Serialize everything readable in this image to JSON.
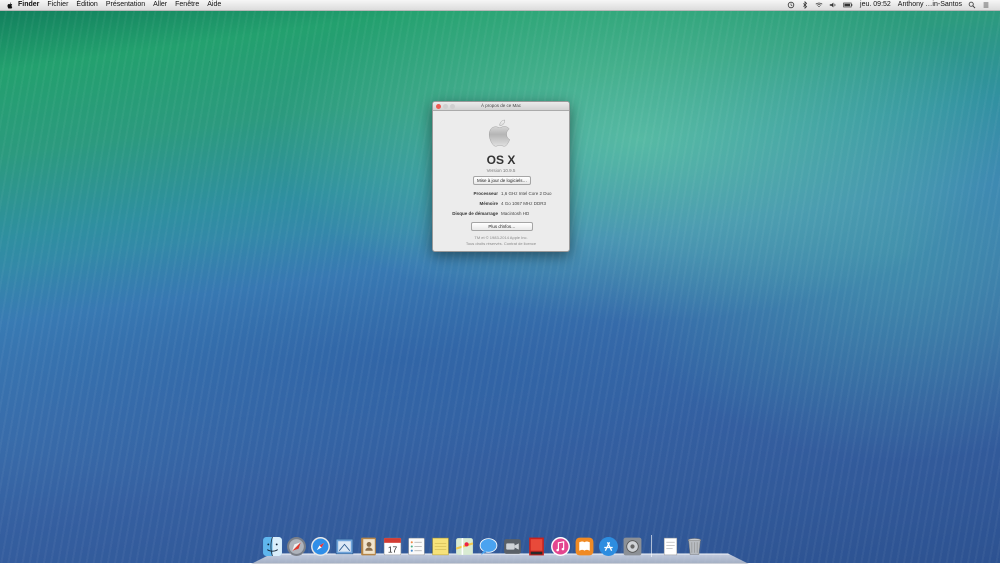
{
  "menubar": {
    "app_name": "Finder",
    "menus": [
      "Fichier",
      "Édition",
      "Présentation",
      "Aller",
      "Fenêtre",
      "Aide"
    ],
    "status": {
      "datetime": "jeu. 09:52",
      "user": "Anthony …in-Santos"
    }
  },
  "about_window": {
    "title": "À propos de ce Mac",
    "os_name": "OS X",
    "version": "Version 10.9.5",
    "update_button": "Mise à jour de logiciels…",
    "specs": [
      {
        "label": "Processeur",
        "value": "1,6 GHz Intel Core 2 Duo"
      },
      {
        "label": "Mémoire",
        "value": "4 Go 1067 MHz  DDR3"
      },
      {
        "label": "Disque de démarrage",
        "value": "Macintosh HD"
      }
    ],
    "more_button": "Plus d'infos…",
    "copyright_line1": "TM et © 1983-2014 Apple Inc.",
    "copyright_line2": "Tous droits réservés.  Contrat de licence"
  },
  "dock": {
    "apps": [
      "finder-icon",
      "launchpad-icon",
      "safari-icon",
      "mail-icon",
      "contacts-icon",
      "calendar-icon",
      "reminders-icon",
      "notes-icon",
      "maps-icon",
      "messages-icon",
      "facetime-icon",
      "photo-booth-icon",
      "itunes-icon",
      "ibooks-icon",
      "app-store-icon",
      "system-preferences-icon"
    ],
    "calendar_day": "17",
    "stack_items": [
      "documents-icon",
      "trash-icon"
    ]
  },
  "colors": {
    "close_button": "#ee5b51",
    "wallpaper_top": "#23a06e",
    "wallpaper_bottom": "#2d5291"
  }
}
